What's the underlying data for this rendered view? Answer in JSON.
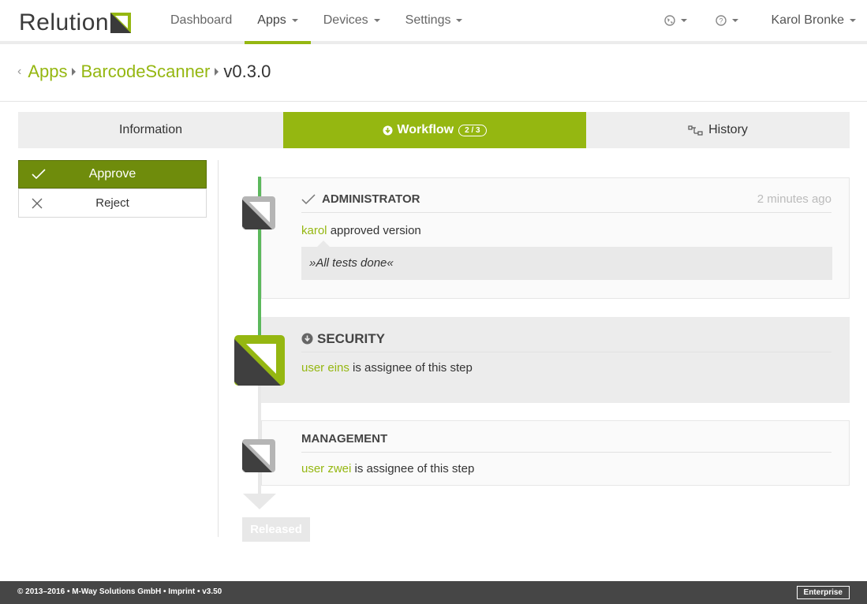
{
  "brand": {
    "name": "Relution",
    "accent": "#95b711",
    "dark": "#3a3a3a"
  },
  "nav": {
    "items": [
      {
        "label": "Dashboard",
        "active": false,
        "dropdown": false
      },
      {
        "label": "Apps",
        "active": true,
        "dropdown": true
      },
      {
        "label": "Devices",
        "active": false,
        "dropdown": true
      },
      {
        "label": "Settings",
        "active": false,
        "dropdown": true
      }
    ],
    "right": {
      "globe_icon": "globe-icon",
      "help_icon": "help-icon",
      "user": "Karol Bronke"
    }
  },
  "breadcrumb": {
    "items": [
      "Apps",
      "BarcodeScanner"
    ],
    "current": "v0.3.0"
  },
  "tabs": {
    "information": "Information",
    "workflow": "Workflow",
    "workflow_badge": "2 / 3",
    "history": "History"
  },
  "actions": {
    "approve": "Approve",
    "reject": "Reject"
  },
  "workflow": {
    "steps": [
      {
        "title": "ADMINISTRATOR",
        "time": "2 minutes ago",
        "user": "karol",
        "text": "approved version",
        "comment": "»All tests done«",
        "status": "approved"
      },
      {
        "title": "SECURITY",
        "user": "user eins",
        "text": "is assignee of this step",
        "status": "current"
      },
      {
        "title": "MANAGEMENT",
        "user": "user zwei",
        "text": "is assignee of this step",
        "status": "pending"
      }
    ],
    "released": "Released"
  },
  "footer": {
    "text": "© 2013–2016 • M-Way Solutions GmbH • Imprint • v3.50",
    "edition": "Enterprise"
  }
}
